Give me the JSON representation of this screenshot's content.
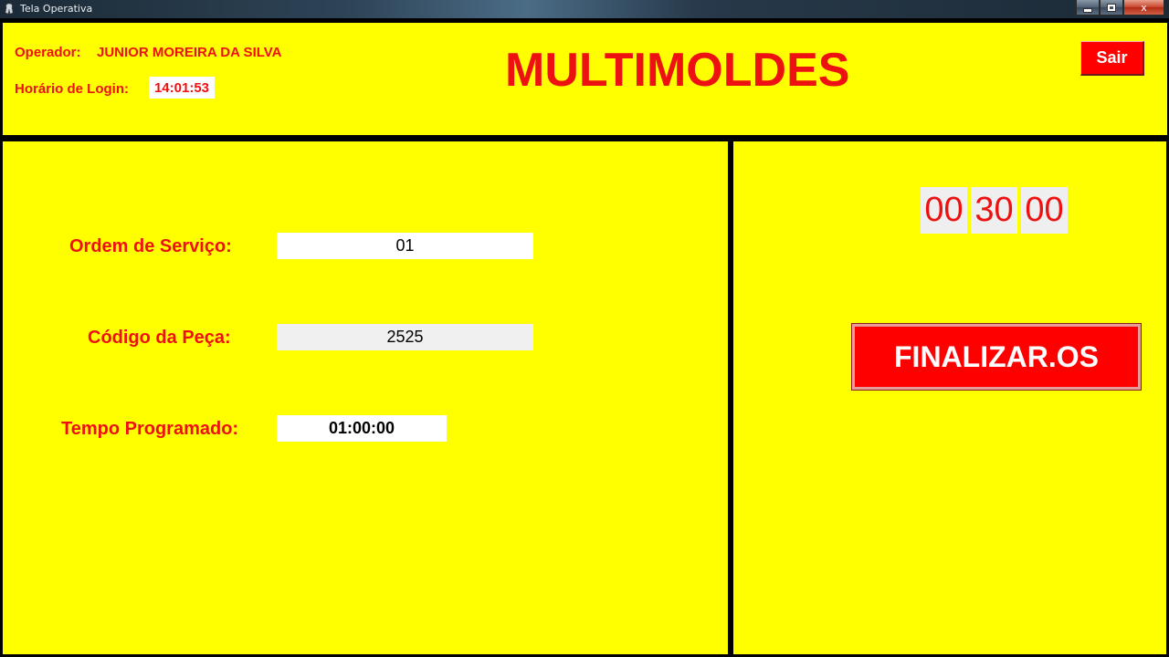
{
  "window": {
    "title": "Tela Operativa",
    "close_glyph": "x"
  },
  "header": {
    "operator_label": "Operador:",
    "operator_name": "JUNIOR MOREIRA DA SILVA",
    "login_label": "Horário de Login:",
    "login_time": "14:01:53",
    "app_title": "MULTIMOLDES",
    "exit_label": "Sair"
  },
  "form": {
    "service_order_label": "Ordem de Serviço:",
    "service_order_value": "01",
    "part_code_label": "Código da Peça:",
    "part_code_value": "2525",
    "scheduled_time_label": "Tempo Programado:",
    "scheduled_time_value": "01:00:00"
  },
  "timer": {
    "hours": "00",
    "minutes": "30",
    "seconds": "00"
  },
  "actions": {
    "finalize_label": "FINALIZAR.OS"
  },
  "colors": {
    "panel_background": "#ffff00",
    "accent_red": "#ee1111",
    "button_red": "#ff0000"
  }
}
